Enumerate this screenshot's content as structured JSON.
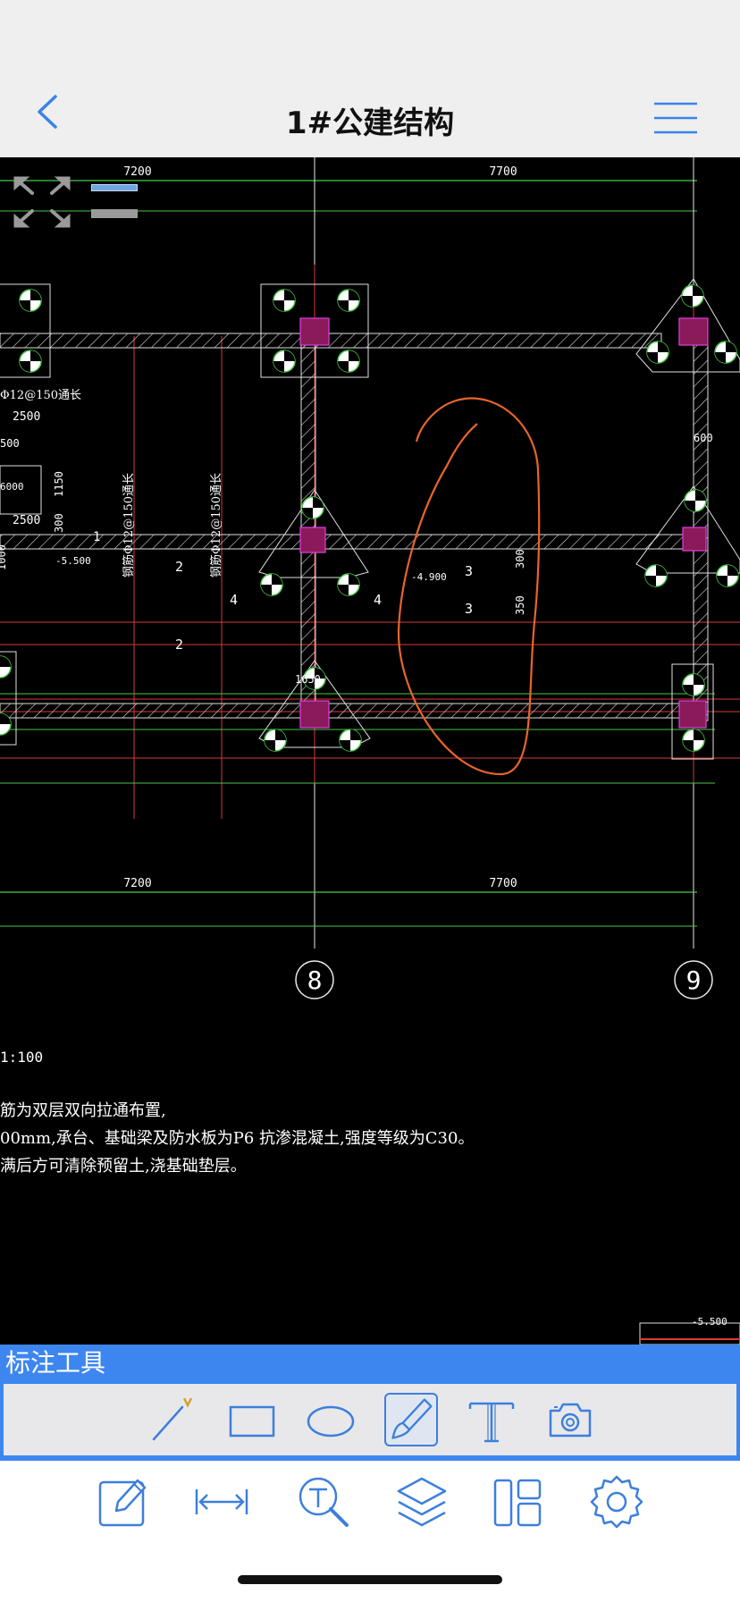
{
  "app": {
    "title": "1#公建结构"
  },
  "navbar": {
    "back_icon": "chevron-left-icon",
    "menu_icon": "hamburger-menu-icon"
  },
  "drawing": {
    "dims_top": [
      "7200",
      "7700"
    ],
    "dims_bottom": [
      "7200",
      "7700"
    ],
    "axis_labels": [
      "8",
      "9"
    ],
    "scale_label": "1:100",
    "notes": [
      "筋为双层双向拉通布置,",
      "00mm,承台、基础梁及防水板为P6 抗渗混凝土,强度等级为C30。",
      "满后方可清除预留土,浇基础垫层。"
    ],
    "labels": {
      "rebar_note_1": "钢筋Φ12@150通长",
      "rebar_note_2": "钢筋Φ12@150通长",
      "rebar_note_3": "Φ12@150通长",
      "dim_2500_a": "2500",
      "dim_500": "500",
      "dim_6000": "6000",
      "dim_2500_b": "2500",
      "dim_1150": "1150",
      "dim_300v": "300",
      "dim_1000": "1000",
      "elev_1": "-5.500",
      "elev_2": "-4.900",
      "elev_3": "-5.500",
      "sec_1": "1",
      "sec_2a": "2",
      "sec_2b": "2",
      "sec_3a": "3",
      "sec_3b": "3",
      "sec_4a": "4",
      "sec_4b": "4",
      "dim_300": "300",
      "dim_350": "350",
      "dim_600": "600",
      "dim_1650": "1650"
    }
  },
  "annotation_toolbar": {
    "title": "标注工具",
    "tools": [
      "line-tool-icon",
      "rectangle-tool-icon",
      "ellipse-tool-icon",
      "brush-tool-icon",
      "text-tool-icon",
      "camera-icon"
    ],
    "active_tool": "brush-tool-icon",
    "accent_color": "#3d86ef",
    "markup_color": "#e8642c"
  },
  "bottom_toolbar": {
    "tools": [
      "edit-icon",
      "measure-icon",
      "text-search-icon",
      "layers-icon",
      "layout-icon",
      "settings-icon"
    ]
  }
}
